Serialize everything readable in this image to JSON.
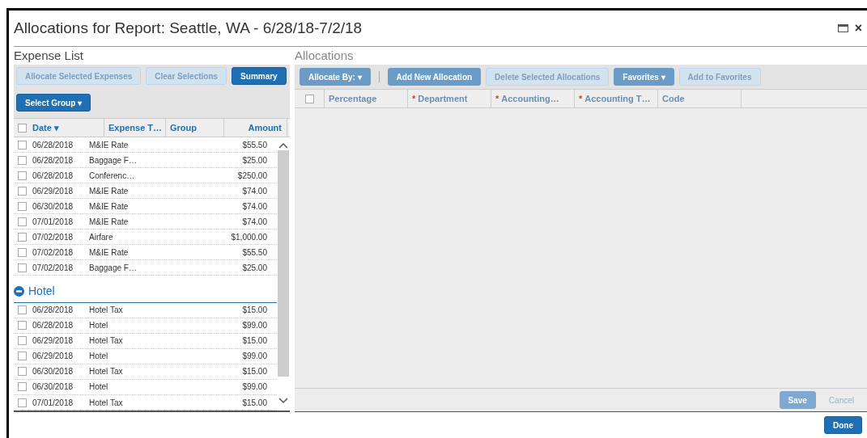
{
  "window": {
    "title": "Allocations for Report: Seattle, WA - 6/28/18-7/2/18",
    "close_icon": "×"
  },
  "expense_list": {
    "title": "Expense List",
    "buttons": [
      {
        "label": "Allocate Selected Expenses",
        "disabled": true
      },
      {
        "label": "Clear Selections",
        "disabled": true
      },
      {
        "label": "Summary",
        "disabled": false
      }
    ],
    "select_group": "Select Group ▾",
    "columns": [
      "Date ▾",
      "Expense T…",
      "Group",
      "Amount"
    ],
    "header_checked": false,
    "rows": [
      {
        "date": "06/28/2018",
        "type": "M&IE Rate",
        "amount": "$55.50",
        "checked": false
      },
      {
        "date": "06/28/2018",
        "type": "Baggage F…",
        "amount": "$25.00",
        "checked": false
      },
      {
        "date": "06/28/2018",
        "type": "Conferenc…",
        "amount": "$250.00",
        "checked": false
      },
      {
        "date": "06/29/2018",
        "type": "M&IE Rate",
        "amount": "$74.00",
        "checked": false
      },
      {
        "date": "06/30/2018",
        "type": "M&IE Rate",
        "amount": "$74.00",
        "checked": false
      },
      {
        "date": "07/01/2018",
        "type": "M&IE Rate",
        "amount": "$74.00",
        "checked": false
      },
      {
        "date": "07/02/2018",
        "type": "Airfare",
        "amount": "$1,000.00",
        "checked": false
      },
      {
        "date": "07/02/2018",
        "type": "M&IE Rate",
        "amount": "$55.50",
        "checked": false
      },
      {
        "date": "07/02/2018",
        "type": "Baggage F…",
        "amount": "$25.00",
        "checked": false
      }
    ],
    "groups": [
      {
        "label": "Hotel",
        "expanded": true,
        "rows": [
          {
            "date": "06/28/2018",
            "type": "Hotel Tax",
            "amount": "$15.00",
            "checked": false
          },
          {
            "date": "06/28/2018",
            "type": "Hotel",
            "amount": "$99.00",
            "checked": false
          },
          {
            "date": "06/29/2018",
            "type": "Hotel Tax",
            "amount": "$15.00",
            "checked": false
          },
          {
            "date": "06/29/2018",
            "type": "Hotel",
            "amount": "$99.00",
            "checked": false
          },
          {
            "date": "06/30/2018",
            "type": "Hotel Tax",
            "amount": "$15.00",
            "checked": false
          },
          {
            "date": "06/30/2018",
            "type": "Hotel",
            "amount": "$99.00",
            "checked": false
          },
          {
            "date": "07/01/2018",
            "type": "Hotel Tax",
            "amount": "$15.00",
            "checked": false
          }
        ]
      }
    ]
  },
  "allocations": {
    "title": "Allocations",
    "dimmed": true,
    "buttons": [
      {
        "label": "Allocate By: ▾",
        "disabled": false
      },
      {
        "label": "Add New Allocation",
        "disabled": false
      },
      {
        "label": "Delete Selected Allocations",
        "disabled": true
      },
      {
        "label": "Favorites ▾",
        "disabled": false
      },
      {
        "label": "Add to Favorites",
        "disabled": true
      }
    ],
    "header_checked": false,
    "required_mark": "*",
    "columns": [
      {
        "label": "Percentage",
        "required": false
      },
      {
        "label": "Department",
        "required": true
      },
      {
        "label": "Accounting…",
        "required": true
      },
      {
        "label": "Accounting T…",
        "required": true
      },
      {
        "label": "Code",
        "required": false
      }
    ],
    "footer_buttons": [
      {
        "label": "Save",
        "kind": "primary"
      },
      {
        "label": "Cancel",
        "kind": "link"
      }
    ]
  },
  "done_button": "Done"
}
